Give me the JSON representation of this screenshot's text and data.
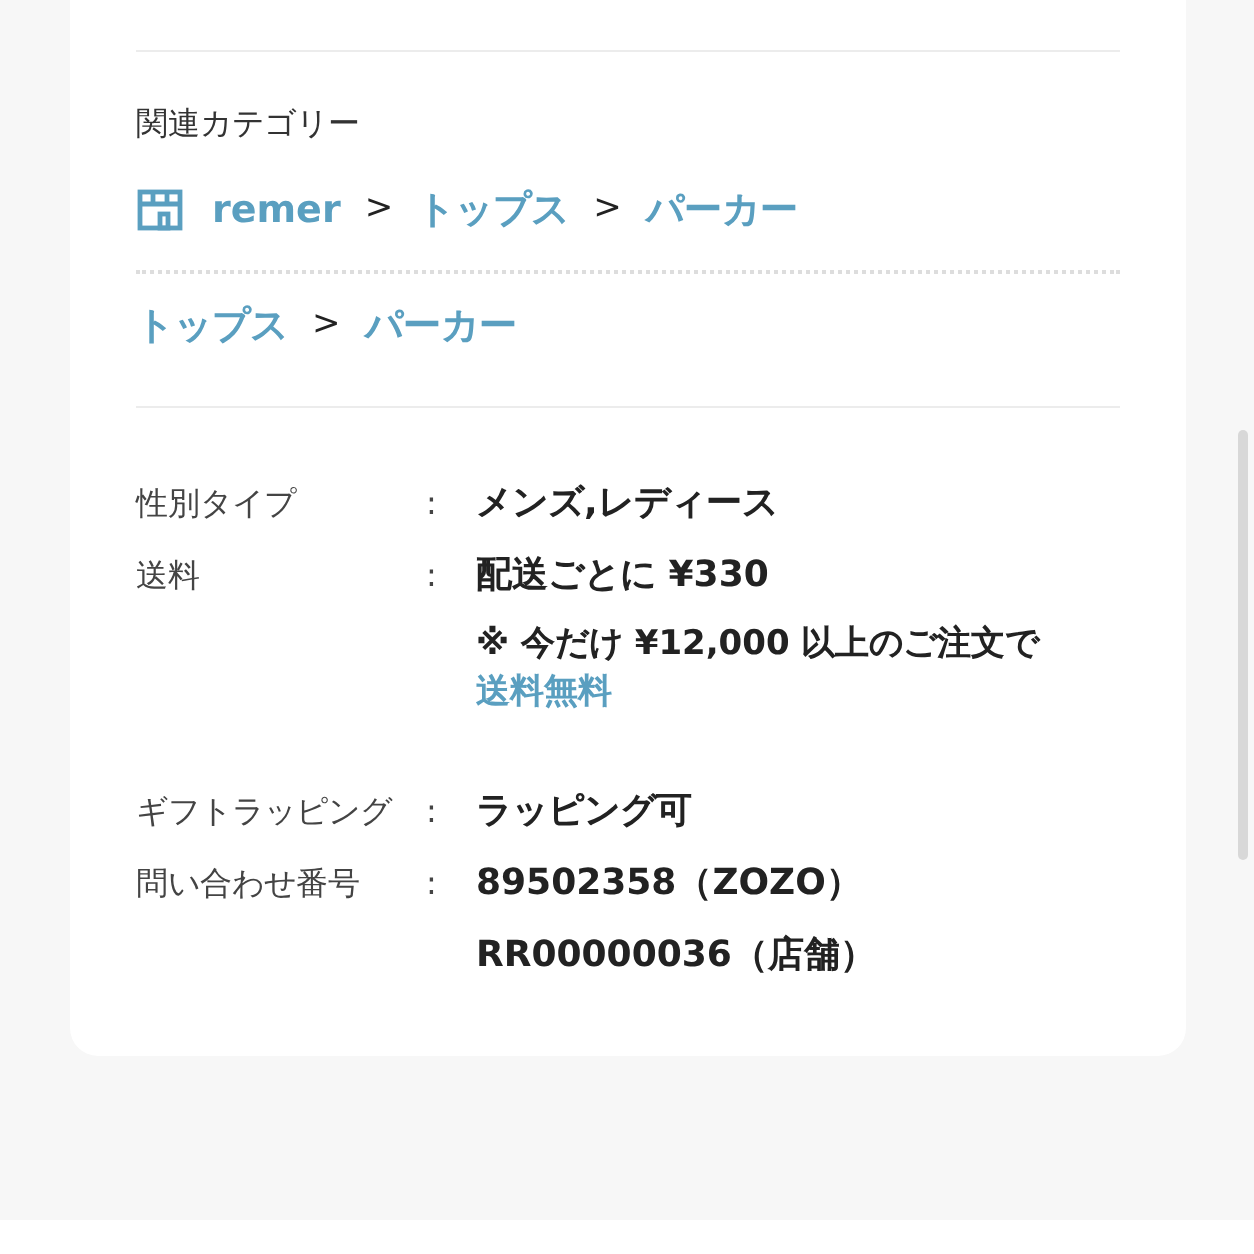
{
  "related_categories": {
    "title": "関連カテゴリー",
    "paths": [
      {
        "separator": ">",
        "items": [
          {
            "label": "remer",
            "kind": "shop"
          },
          {
            "label": "トップス",
            "kind": "category"
          },
          {
            "label": "パーカー",
            "kind": "category"
          }
        ]
      },
      {
        "separator": ">",
        "items": [
          {
            "label": "トップス",
            "kind": "category"
          },
          {
            "label": "パーカー",
            "kind": "category"
          }
        ]
      }
    ]
  },
  "details": [
    {
      "label": "性別タイプ",
      "colon": ":",
      "lines": [
        {
          "text": "メンズ,レディース",
          "kind": "value"
        }
      ]
    },
    {
      "label": "送料",
      "colon": ":",
      "lines": [
        {
          "text": "配送ごとに ¥330",
          "kind": "value"
        },
        {
          "text": "※ 今だけ ¥12,000 以上のご注文で",
          "kind": "note"
        },
        {
          "text": "送料無料",
          "kind": "link"
        }
      ]
    },
    {
      "label": "ギフトラッピング",
      "colon": ":",
      "lines": [
        {
          "text": "ラッピング可",
          "kind": "value"
        }
      ]
    },
    {
      "label": "問い合わせ番号",
      "colon": ":",
      "lines": [
        {
          "text": "89502358（ZOZO）",
          "kind": "value"
        },
        {
          "text": "RR00000036（店舗）",
          "kind": "value"
        }
      ]
    }
  ]
}
